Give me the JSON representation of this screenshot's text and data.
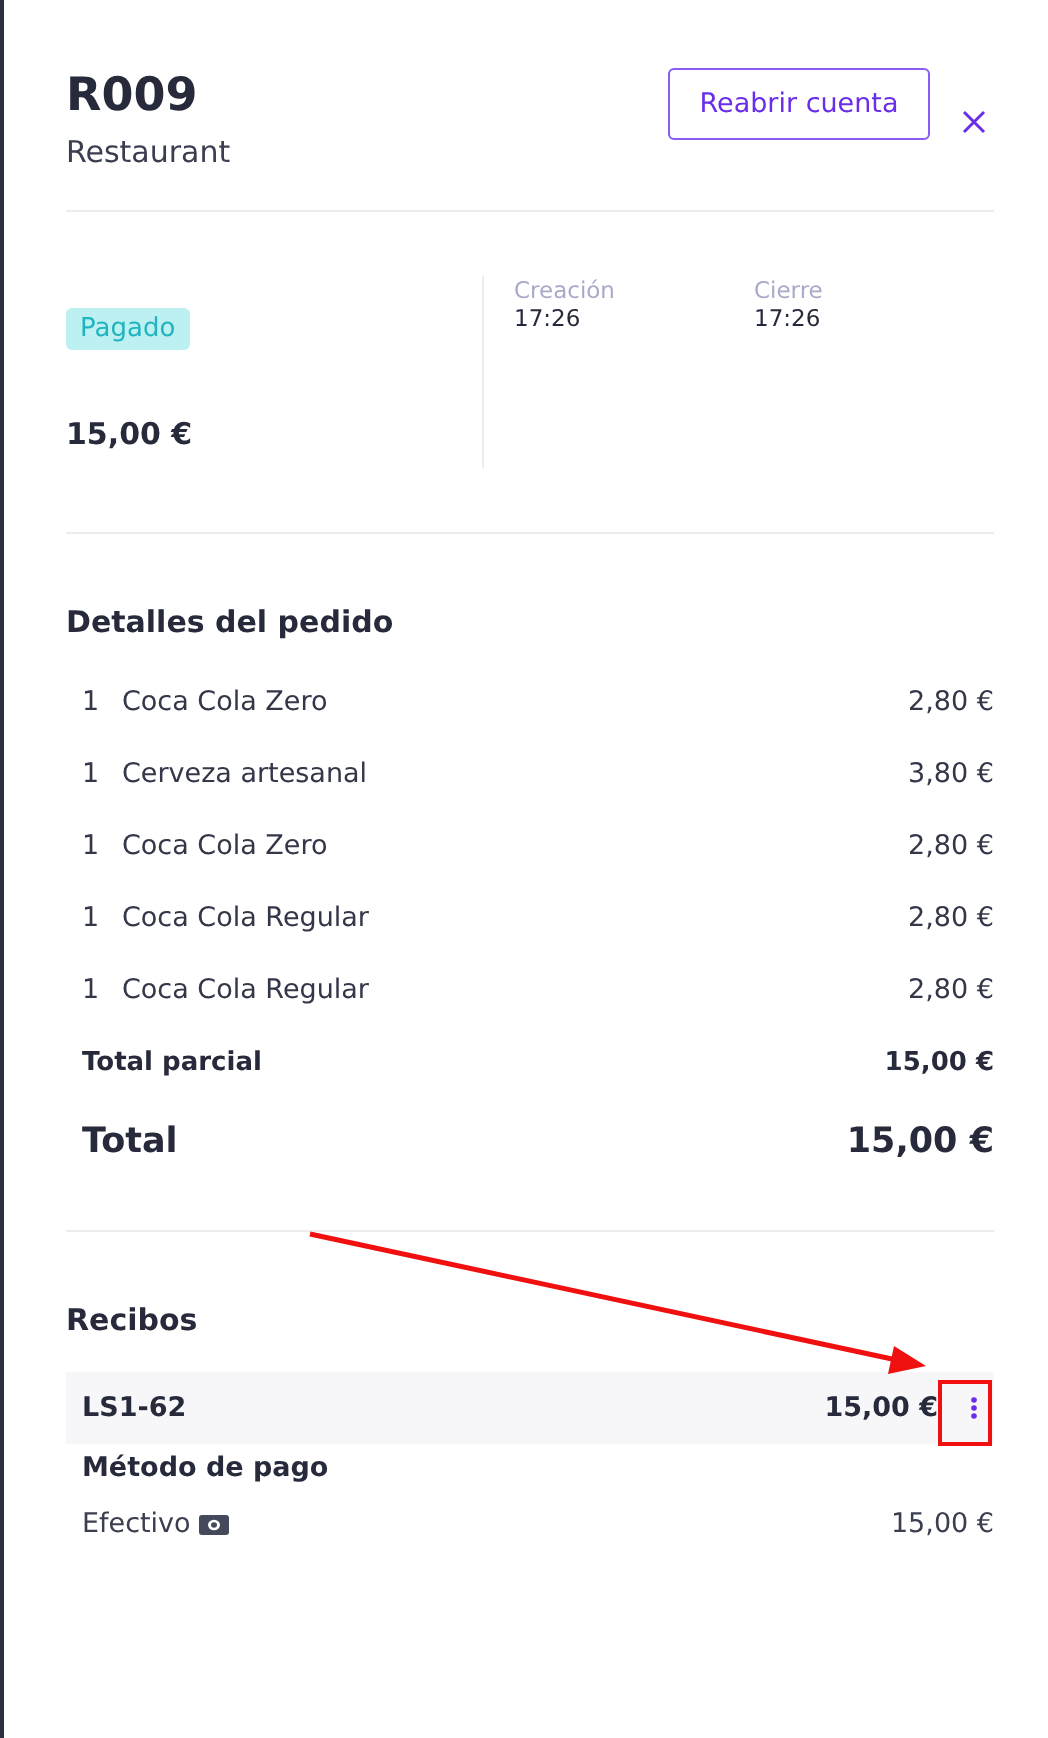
{
  "header": {
    "title": "R009",
    "subtitle": "Restaurant",
    "reopen_button": "Reabrir cuenta"
  },
  "summary": {
    "status": "Pagado",
    "amount": "15,00 €",
    "times": [
      {
        "label": "Creación",
        "value": "17:26"
      },
      {
        "label": "Cierre",
        "value": "17:26"
      }
    ]
  },
  "order": {
    "heading": "Detalles del pedido",
    "items": [
      {
        "qty": "1",
        "name": "Coca Cola Zero",
        "price": "2,80 €"
      },
      {
        "qty": "1",
        "name": "Cerveza artesanal",
        "price": "3,80 €"
      },
      {
        "qty": "1",
        "name": "Coca Cola Zero",
        "price": "2,80 €"
      },
      {
        "qty": "1",
        "name": "Coca Cola Regular",
        "price": "2,80 €"
      },
      {
        "qty": "1",
        "name": "Coca Cola Regular",
        "price": "2,80 €"
      }
    ],
    "subtotal": {
      "label": "Total parcial",
      "value": "15,00 €"
    },
    "total": {
      "label": "Total",
      "value": "15,00 €"
    }
  },
  "receipts": {
    "heading": "Recibos",
    "items": [
      {
        "id": "LS1-62",
        "amount": "15,00 €",
        "method_heading": "Método de pago",
        "payments": [
          {
            "method": "Efectivo",
            "amount": "15,00 €"
          }
        ]
      }
    ]
  }
}
